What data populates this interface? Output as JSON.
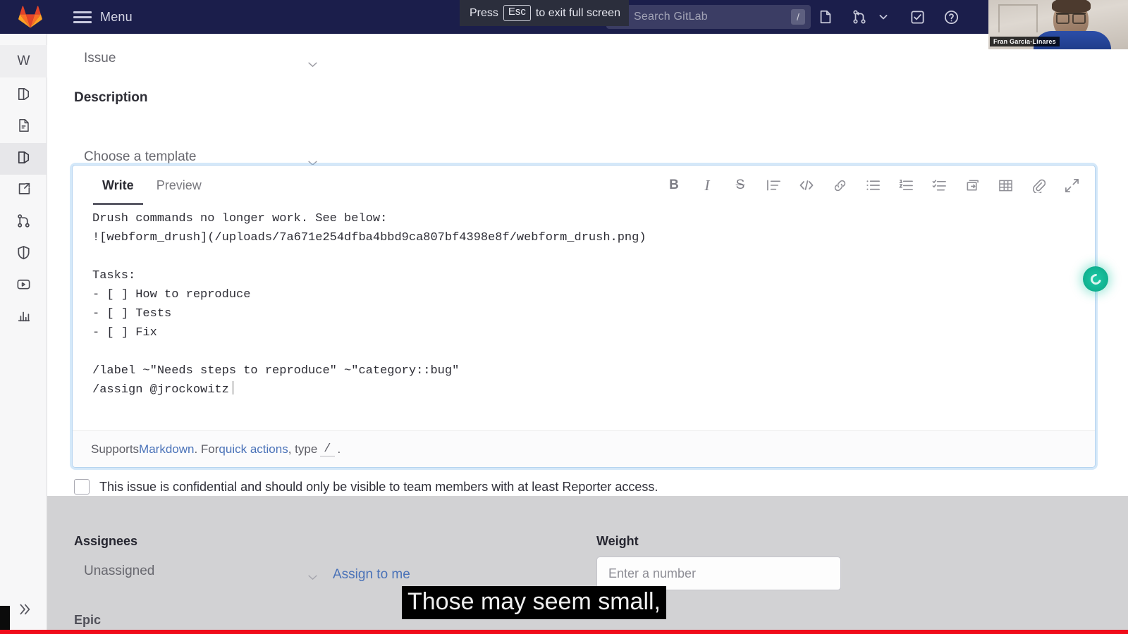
{
  "navbar": {
    "logo_icon": "gitlab-tanuki-logo",
    "menu_icon": "hamburger-menu-icon",
    "menu_label": "Menu",
    "search": {
      "icon": "search-icon",
      "placeholder": "Search GitLab",
      "value": "",
      "shortcut": "/"
    },
    "icons": [
      {
        "name": "issues-icon",
        "label": "Issues"
      },
      {
        "name": "merge-requests-icon",
        "label": "Merge requests"
      },
      {
        "name": "chevron-down-icon",
        "label": "Merge requests dropdown"
      },
      {
        "name": "todos-icon",
        "label": "To-Do List"
      },
      {
        "name": "help-icon",
        "label": "Help"
      }
    ],
    "background_color": "#1b1e4b"
  },
  "fullscreen_hint": {
    "prefix": "Press",
    "key": "Esc",
    "suffix": "to exit full screen"
  },
  "webcam": {
    "presenter_name": "Fran Garcia-Linares"
  },
  "sidebar": {
    "project_initial": "W",
    "expand_icon": "double-chevron-right-icon",
    "items": [
      {
        "name": "sidebar-item-project",
        "icon": "project-avatar-icon",
        "label": "W",
        "active": false
      },
      {
        "name": "sidebar-item-overview",
        "icon": "book-overview-icon",
        "label": "Overview",
        "active": false
      },
      {
        "name": "sidebar-item-repository",
        "icon": "document-icon",
        "label": "Repository",
        "active": false
      },
      {
        "name": "sidebar-item-issues",
        "icon": "issues-icon",
        "label": "Issues",
        "active": true
      },
      {
        "name": "sidebar-item-external-link",
        "icon": "external-link-icon",
        "label": "External wiki",
        "active": false
      },
      {
        "name": "sidebar-item-merge-requests",
        "icon": "merge-requests-icon",
        "label": "Merge requests",
        "active": false
      },
      {
        "name": "sidebar-item-security",
        "icon": "shield-icon",
        "label": "Security & Compliance",
        "active": false
      },
      {
        "name": "sidebar-item-deployments",
        "icon": "deploy-package-icon",
        "label": "Deployments",
        "active": false
      },
      {
        "name": "sidebar-item-analytics",
        "icon": "bar-chart-icon",
        "label": "Analytics",
        "active": false
      }
    ]
  },
  "form": {
    "type_select": {
      "value": "Issue",
      "chevron_icon": "chevron-down-icon"
    },
    "description_heading": "Description",
    "template_select": {
      "value": "Choose a template",
      "chevron_icon": "chevron-down-icon"
    },
    "editor": {
      "tabs": [
        {
          "label": "Write",
          "active": true
        },
        {
          "label": "Preview",
          "active": false
        }
      ],
      "toolbar": [
        {
          "name": "bold-icon",
          "glyph": "B",
          "label": "Add bold text"
        },
        {
          "name": "italic-icon",
          "glyph": "I",
          "label": "Add italic text"
        },
        {
          "name": "strikethrough-icon",
          "glyph": "S",
          "label": "Add strikethrough text"
        },
        {
          "name": "heading-icon",
          "glyph": "",
          "label": "Add a heading"
        },
        {
          "name": "code-icon",
          "glyph": "</>",
          "label": "Insert code"
        },
        {
          "name": "link-icon",
          "glyph": "",
          "label": "Insert a link"
        },
        {
          "name": "bullet-list-icon",
          "glyph": "",
          "label": "Add a bullet list"
        },
        {
          "name": "numbered-list-icon",
          "glyph": "",
          "label": "Add a numbered list"
        },
        {
          "name": "checklist-icon",
          "glyph": "",
          "label": "Add a checklist"
        },
        {
          "name": "collapsible-section-icon",
          "glyph": "",
          "label": "Add a collapsible section"
        },
        {
          "name": "table-icon",
          "glyph": "",
          "label": "Add a table"
        },
        {
          "name": "attachment-icon",
          "glyph": "",
          "label": "Attach a file or image"
        },
        {
          "name": "fullscreen-icon",
          "glyph": "",
          "label": "Go full screen"
        }
      ],
      "content": "Drush commands no longer work. See below:\n![webform_drush](/uploads/7a671e254dfba4bbd9ca807bf4398e8f/webform_drush.png)\n\nTasks:\n- [ ] How to reproduce\n- [ ] Tests\n- [ ] Fix\n\n/label ~\"Needs steps to reproduce\" ~\"category::bug\"\n/assign @jrockowitz",
      "footer": {
        "prefix": "Supports ",
        "markdown_link": "Markdown",
        "mid": ". For ",
        "quick_actions_link": "quick actions",
        "mid2": ", type ",
        "slash": "/",
        "suffix": "."
      },
      "border_color": "#b6d4f0"
    },
    "duo_orb": {
      "name": "gitlab-duo-orb",
      "color": "#12b694"
    },
    "confidential": {
      "checked": false,
      "label": "This issue is confidential and should only be visible to team members with at least Reporter access."
    },
    "assignees": {
      "heading": "Assignees",
      "select_value": "Unassigned",
      "chevron_icon": "chevron-down-icon",
      "assign_to_me_label": "Assign to me"
    },
    "weight": {
      "heading": "Weight",
      "placeholder": "Enter a number",
      "value": ""
    },
    "epic": {
      "heading": "Epic"
    }
  },
  "video_overlay": {
    "caption": "Those may seem small,",
    "progress_color": "#f00c1a",
    "progress_percent": 100
  }
}
